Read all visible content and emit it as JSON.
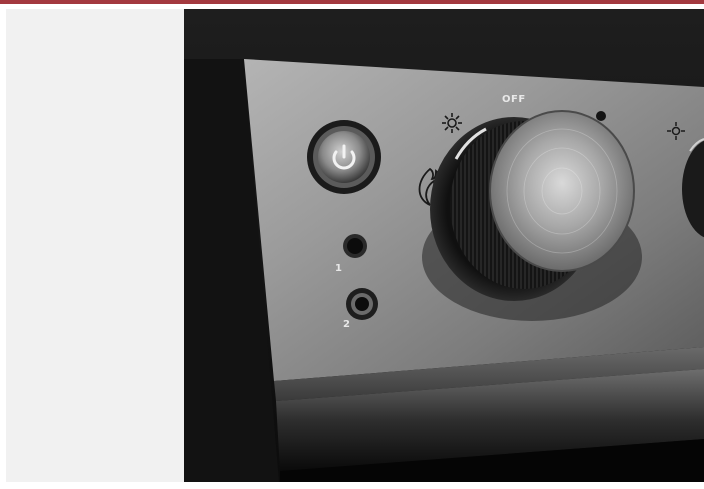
{
  "colors": {
    "accent_bar": "#a3393f",
    "sidebar_bg": "#f1f1f1",
    "panel_metal": "#8f8f8f"
  },
  "photo": {
    "icons": [
      "power-icon",
      "sun-icon",
      "flame-icon"
    ],
    "labels": {
      "off": "OFF",
      "jack_1": "1",
      "jack_2": "2"
    }
  }
}
